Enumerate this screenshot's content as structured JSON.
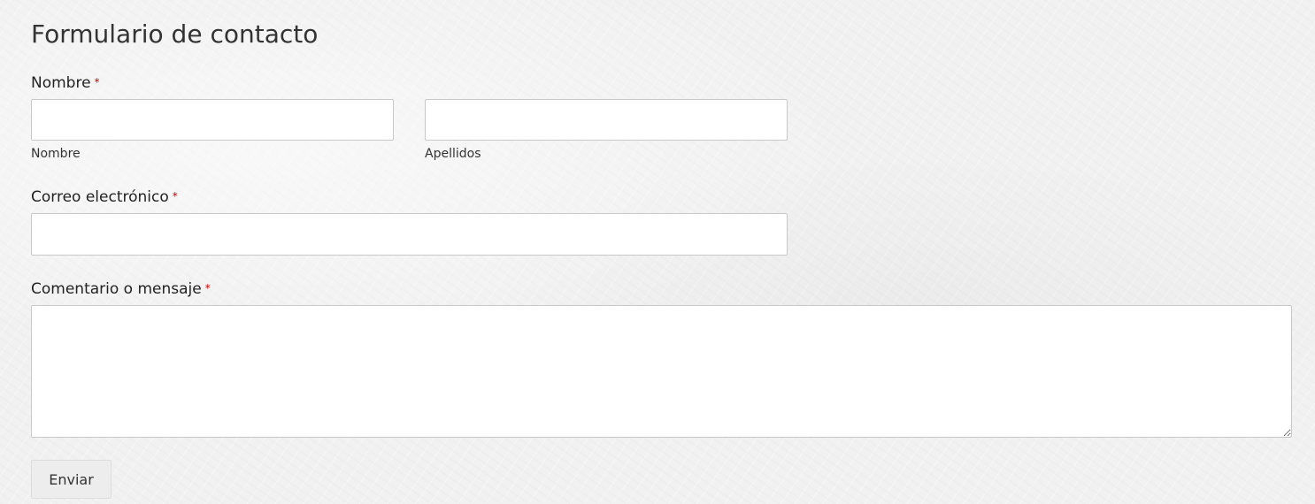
{
  "form": {
    "title": "Formulario de contacto",
    "required_marker": "*",
    "name_field": {
      "label": "Nombre",
      "first_name": {
        "value": "",
        "sublabel": "Nombre"
      },
      "last_name": {
        "value": "",
        "sublabel": "Apellidos"
      }
    },
    "email_field": {
      "label": "Correo electrónico",
      "value": ""
    },
    "message_field": {
      "label": "Comentario o mensaje",
      "value": ""
    },
    "submit_label": "Enviar"
  },
  "colors": {
    "required_marker": "#d10000",
    "background": "#f1f1f1",
    "input_border": "#c8c8c8",
    "button_background": "#ededed"
  }
}
